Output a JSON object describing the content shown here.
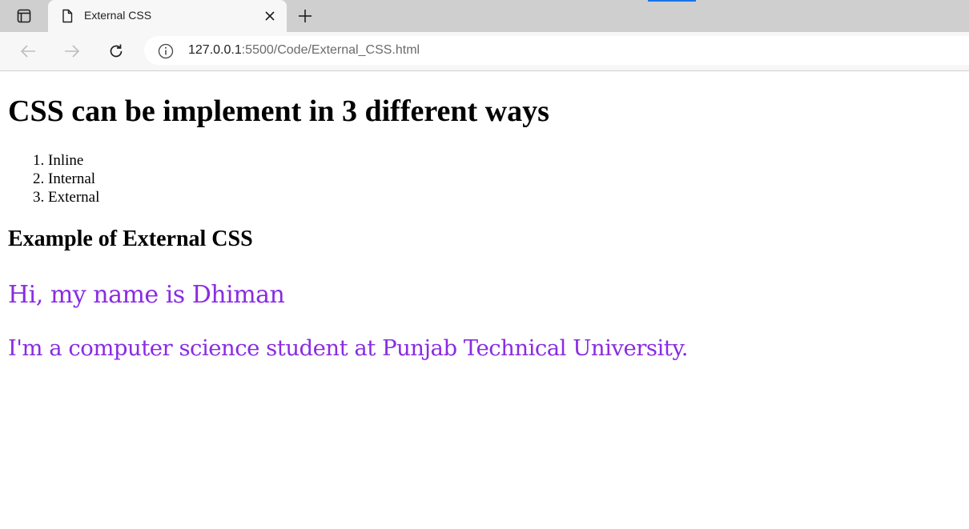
{
  "browser": {
    "tab": {
      "title": "External CSS"
    },
    "address_bar": {
      "host": "127.0.0.1",
      "rest": ":5500/Code/External_CSS.html"
    }
  },
  "page": {
    "heading": "CSS can be implement in 3 different ways",
    "list": [
      "Inline",
      "Internal",
      "External"
    ],
    "subheading": "Example of External CSS",
    "paragraphs": [
      "Hi, my name is Dhiman",
      "I'm a computer science student at Punjab Technical University."
    ],
    "accent_color": "#8a2be2"
  }
}
